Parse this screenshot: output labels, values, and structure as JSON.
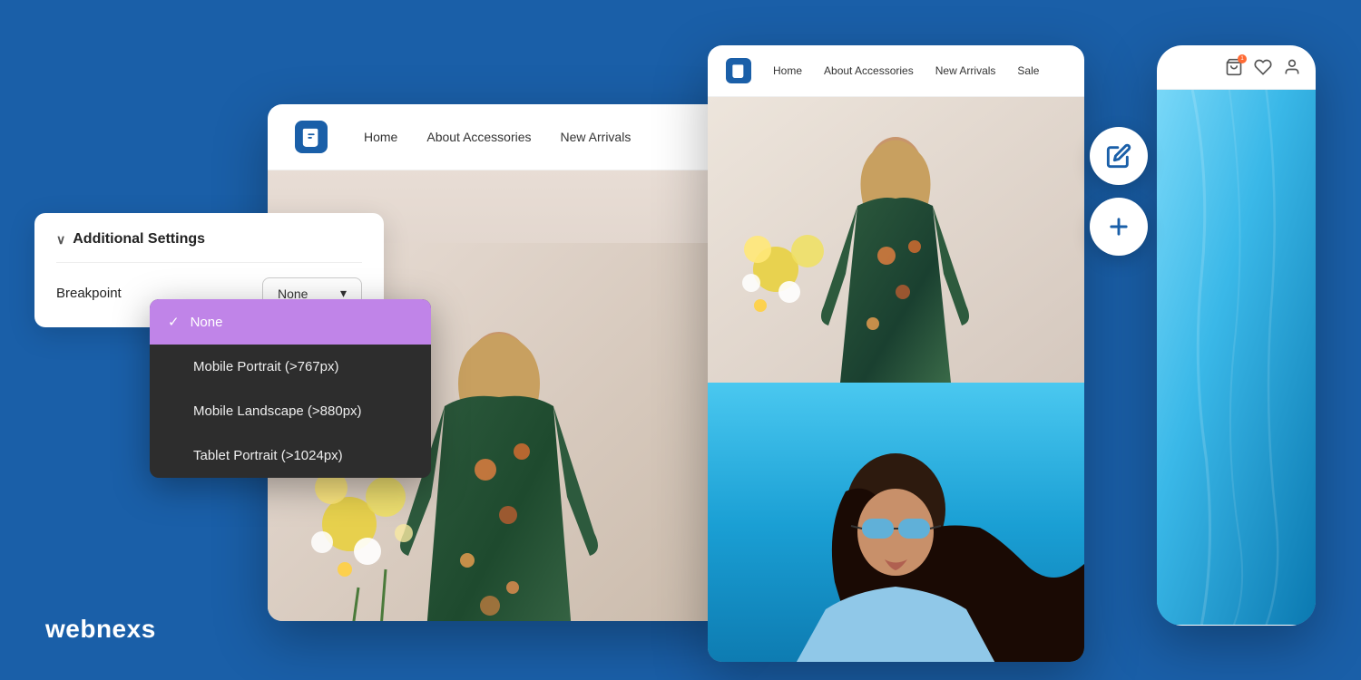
{
  "brand": {
    "name": "webnexs"
  },
  "main_browser": {
    "nav": {
      "links": [
        "Home",
        "About Accessories",
        "New Arrivals"
      ]
    }
  },
  "right_browser": {
    "nav": {
      "links": [
        "Home",
        "About Accessories",
        "New Arrivals",
        "Sale"
      ]
    }
  },
  "settings_panel": {
    "title": "Additional Settings",
    "breakpoint_label": "Breakpoint",
    "dropdown_value": "None",
    "dropdown_chevron": "▾",
    "dropdown_items": [
      {
        "label": "None",
        "selected": true
      },
      {
        "label": "Mobile Portrait (>767px)",
        "selected": false
      },
      {
        "label": "Mobile Landscape (>880px)",
        "selected": false
      },
      {
        "label": "Tablet Portrait (>1024px)",
        "selected": false
      }
    ]
  },
  "fab_buttons": {
    "edit_icon": "✏",
    "add_icon": "+"
  },
  "phone_nav_icons": {
    "bag": "🛍",
    "heart": "♡",
    "user": "👤"
  }
}
